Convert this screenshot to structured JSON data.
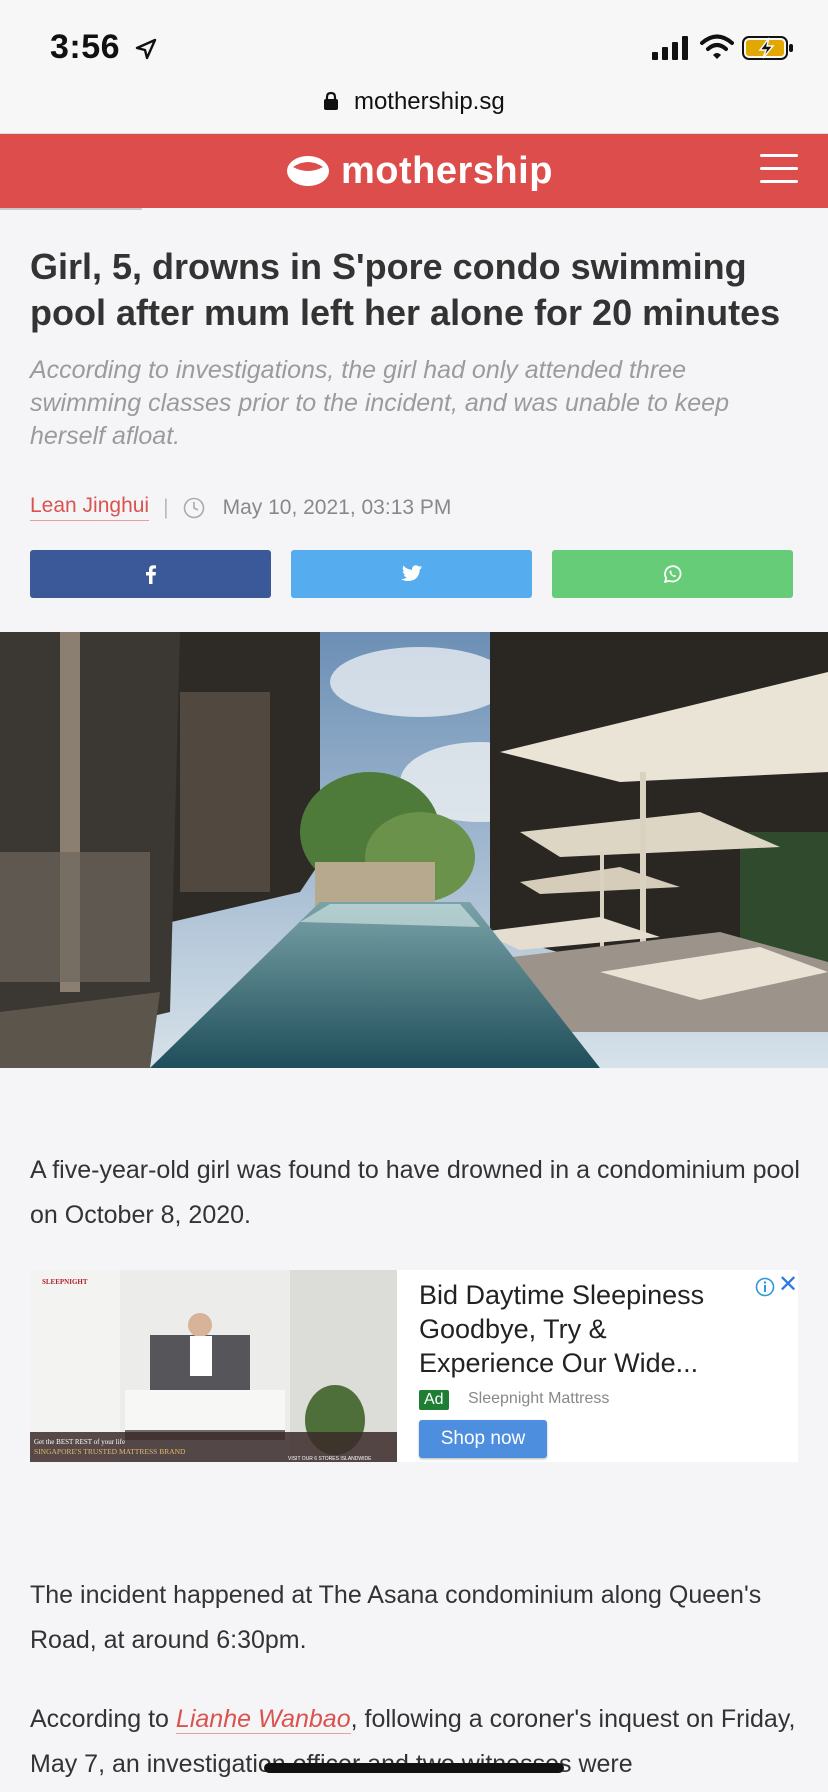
{
  "status_bar": {
    "time": "3:56",
    "icons": [
      "location-arrow-icon",
      "cellular-signal-icon",
      "wifi-icon",
      "battery-charging-icon"
    ]
  },
  "browser": {
    "url": "mothership.sg"
  },
  "site": {
    "logo_text": "mothership",
    "brand_color": "#dd4d4b"
  },
  "article": {
    "title": "Girl, 5, drowns in S'pore condo swimming pool after mum left her alone for 20 minutes",
    "subtitle": "According to investigations, the girl had only attended three swimming classes prior to the incident, and was unable to keep herself afloat.",
    "author": "Lean Jinghui",
    "separator": "|",
    "date": "May 10, 2021, 03:13 PM",
    "share_buttons": [
      {
        "network": "facebook",
        "icon": "facebook-icon",
        "color": "#3b5998"
      },
      {
        "network": "twitter",
        "icon": "twitter-icon",
        "color": "#55acee"
      },
      {
        "network": "whatsapp",
        "icon": "whatsapp-icon",
        "color": "#66cc77"
      }
    ],
    "paragraph_1": "A five-year-old girl was found to have drowned in a condominium pool on October 8, 2020.",
    "paragraph_2": "The incident happened at The Asana condominium along Queen's Road, at around 6:30pm.",
    "paragraph_3_before": "According to ",
    "paragraph_3_link": "Lianhe Wanbao",
    "paragraph_3_after": ", following a coroner's inquest on Friday, May 7, an investigation officer and two witnesses were"
  },
  "ad": {
    "headline": "Bid Daytime Sleepiness Goodbye, Try & Experience Our Wide...",
    "badge": "Ad",
    "advertiser": "Sleepnight Mattress",
    "cta": "Shop now",
    "close": "✕",
    "image_brand": "SLEEPNIGHT",
    "image_tagline_1": "Get the BEST REST of your life",
    "image_tagline_2": "SINGAPORE'S TRUSTED MATTRESS BRAND",
    "image_tagline_3": "VISIT OUR 6 STORES ISLANDWIDE"
  }
}
